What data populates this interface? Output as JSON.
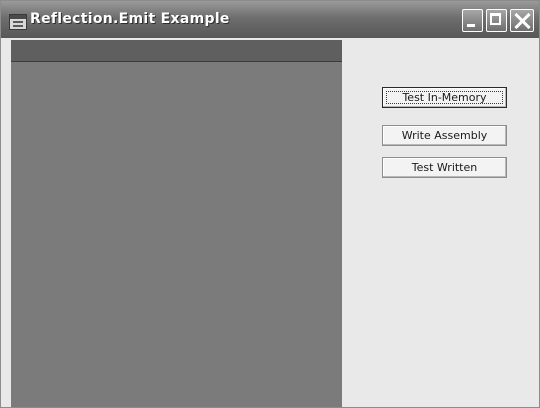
{
  "window": {
    "title": "Reflection.Emit Example",
    "icon": "app-window-icon"
  },
  "titlebar_buttons": {
    "minimize_icon": "minimize-icon",
    "maximize_icon": "maximize-icon",
    "close_icon": "close-icon"
  },
  "buttons": {
    "test_in_memory": "Test In-Memory",
    "write_assembly": "Write Assembly",
    "test_written": "Test Written"
  },
  "focused_button": "test_in_memory"
}
